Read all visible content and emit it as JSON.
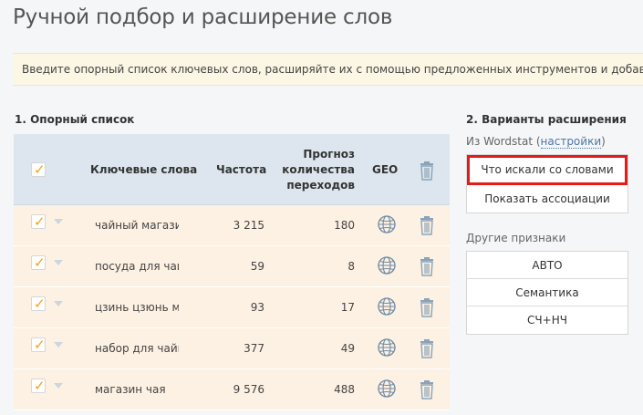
{
  "page": {
    "title": "Ручной подбор и расширение слов",
    "info": "Введите опорный список ключевых слов, расширяйте их с помощью предложенных инструментов и добавляйте"
  },
  "left": {
    "title": "1. Опорный список",
    "columns": {
      "keywords": "Ключевые слова",
      "frequency": "Частота",
      "forecast_line1": "Прогноз",
      "forecast_line2": "количества",
      "forecast_line3": "переходов",
      "geo": "GEO"
    },
    "rows": [
      {
        "keyword": "чайный магазин",
        "frequency": "3 215",
        "forecast": "180"
      },
      {
        "keyword": "посуда для чайной",
        "frequency": "59",
        "forecast": "8"
      },
      {
        "keyword": "цзинь цзюнь магазин",
        "frequency": "93",
        "forecast": "17"
      },
      {
        "keyword": "набор для чайной",
        "frequency": "377",
        "forecast": "49"
      },
      {
        "keyword": "магазин чая",
        "frequency": "9 576",
        "forecast": "488"
      }
    ]
  },
  "right": {
    "title": "2. Варианты расширения",
    "wordstat_prefix": "Из Wordstat (",
    "wordstat_link": "настройки",
    "wordstat_suffix": ")",
    "wordstat_buttons": [
      "Что искали со словами",
      "Показать ассоциации"
    ],
    "other_title": "Другие признаки",
    "other_buttons": [
      "АВТО",
      "Семантика",
      "СЧ+НЧ"
    ]
  },
  "colors": {
    "accent_orange": "#f3a01e",
    "highlight_red": "#e31b1b",
    "link_blue": "#4a76a8",
    "row_bg": "#fdf1e3",
    "header_bg": "#dde6ee"
  }
}
